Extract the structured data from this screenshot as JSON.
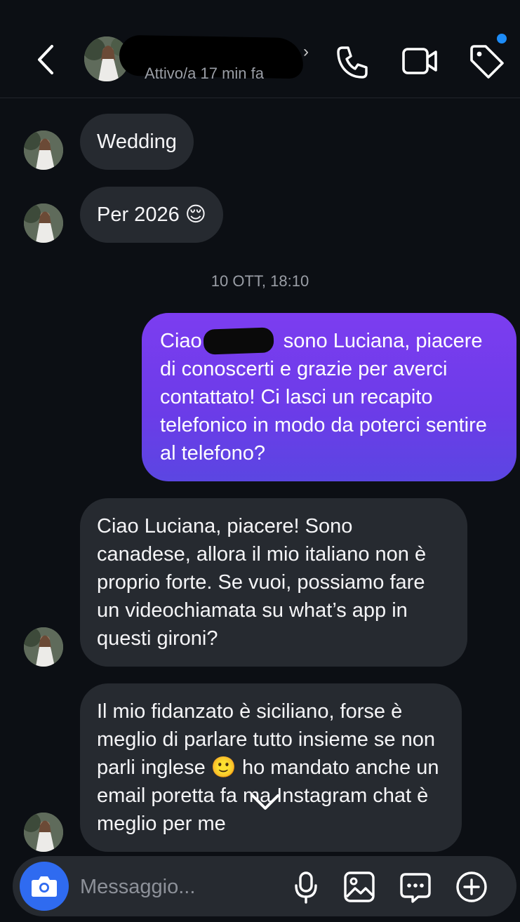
{
  "header": {
    "status": "Attivo/a 17 min fa",
    "icons": [
      "back-icon",
      "phone-icon",
      "video-icon",
      "tag-icon"
    ],
    "notification_dot_color": "#1d8cf8"
  },
  "messages": {
    "m1": "Wedding",
    "m2": "Per 2026 😌",
    "timestamp": "10 OTT, 18:10",
    "out1": {
      "pre": "Ciao ",
      "post": " sono Luciana, piacere di conoscerti e grazie per averci contattato! Ci lasci un recapito telefonico in modo da poterci sentire al telefono?"
    },
    "m3": "Ciao Luciana, piacere! Sono canadese, allora il mio italiano non è proprio forte. Se vuoi, possiamo fare un videochiamata su what’s app in questi gironi?",
    "m4": "Il mio fidanzato è siciliano, forse è meglio di parlare tutto insieme se non parli inglese 🙂 ho mandato anche un email poretta fa ma Instagram chat è meglio per me"
  },
  "colors": {
    "outgoing_bubble_top": "#7c3df0",
    "outgoing_bubble_bottom": "#5b46e2",
    "incoming_bubble": "#262a30",
    "camera_button": "#2f6bf0"
  },
  "composer": {
    "placeholder": "Messaggio...",
    "icons": [
      "camera-icon",
      "mic-icon",
      "gallery-icon",
      "sticker-icon",
      "plus-icon"
    ]
  }
}
